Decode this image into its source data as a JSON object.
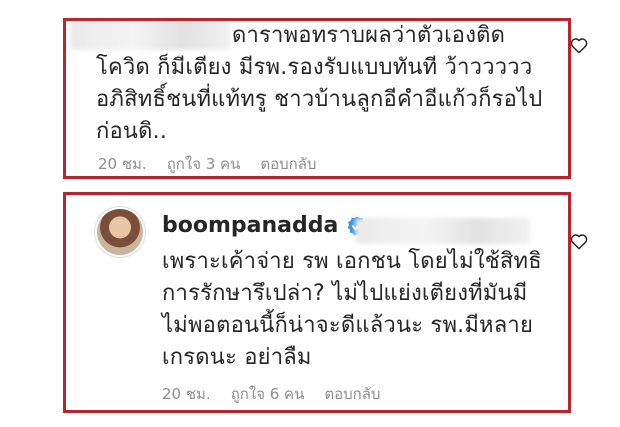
{
  "comment1": {
    "text": "ดาราพอทราบผลว่าตัวเองติด\nโควิด ก็มีเตียง มีรพ.รองรับแบบทันที ว้าววววว\nอภิสิทธิ์ชนที่แท้ทรู ชาวบ้านลูกอีคำอีแก้วก็รอไป\nก่อนดิ..",
    "time": "20 ชม.",
    "likes": "ถูกใจ 3 คน",
    "reply": "ตอบกลับ"
  },
  "comment2": {
    "username": "boompanadda",
    "text": "เพราะเค้าจ่าย รพ เอกชน โดยไม่ใช้สิทธิ\nการรักษารึเปล่า? ไม่ไปแย่งเตียงที่มันมี\nไม่พอตอนนี้ก็น่าจะดีแล้วนะ รพ.มีหลาย\nเกรดนะ อย่าลืม",
    "time": "20 ชม.",
    "likes": "ถูกใจ 6 คน",
    "reply": "ตอบกลับ"
  },
  "colors": {
    "highlight": "#b7262e",
    "verified": "#3897f0",
    "meta_text": "#8e8e8e"
  },
  "icons": {
    "like": "heart-outline-icon",
    "verified": "verified-badge-icon"
  }
}
